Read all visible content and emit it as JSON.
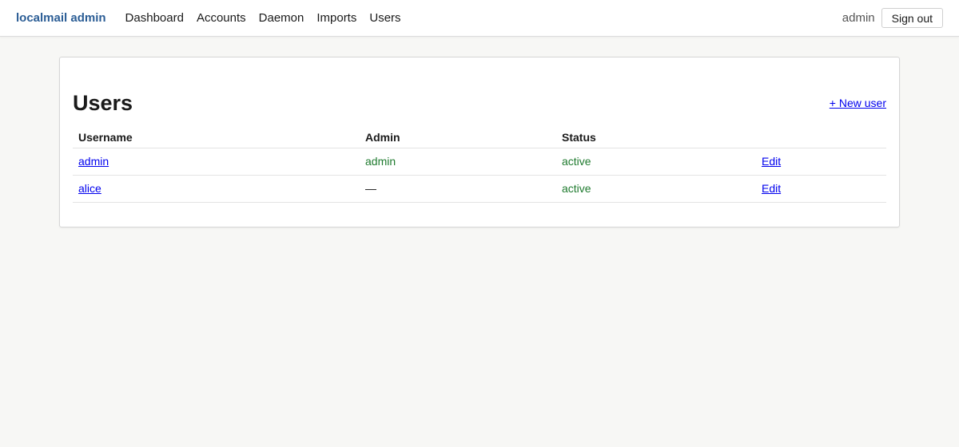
{
  "header": {
    "brand": "localmail admin",
    "nav": [
      "Dashboard",
      "Accounts",
      "Daemon",
      "Imports",
      "Users"
    ],
    "current_user": "admin",
    "signout_label": "Sign out"
  },
  "page": {
    "title": "Users",
    "new_user_label": "+ New user"
  },
  "table": {
    "headers": [
      "Username",
      "Admin",
      "Status",
      ""
    ],
    "rows": [
      {
        "username": "admin",
        "admin": "admin",
        "status": "active",
        "action": "Edit"
      },
      {
        "username": "alice",
        "admin": "—",
        "status": "active",
        "action": "Edit"
      }
    ]
  },
  "colors": {
    "brand": "#2b5d95",
    "link": "#0000ee",
    "status_green": "#1e7a2e",
    "background": "#f7f7f5"
  }
}
